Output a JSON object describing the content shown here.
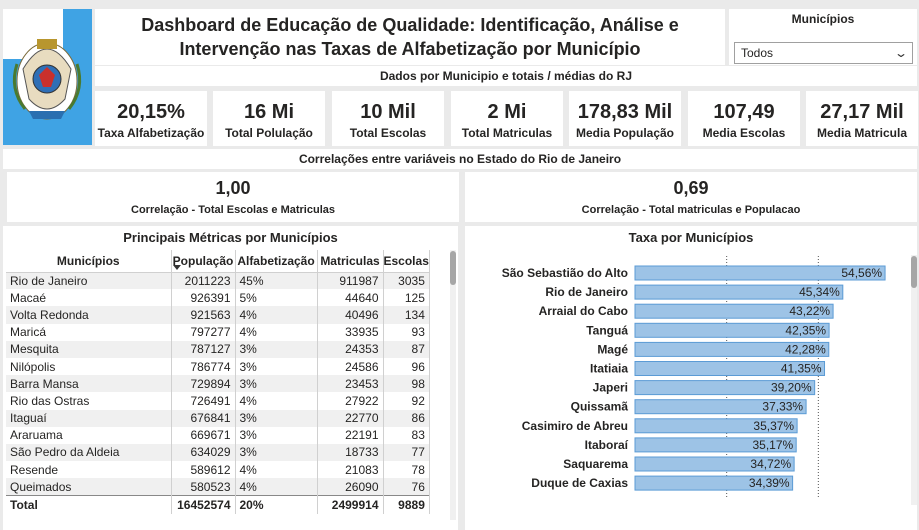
{
  "header": {
    "back_icon": "back-arrow-icon",
    "title": "Dashboard de Educação de Qualidade: Identificação, Análise e Intervenção nas Taxas de Alfabetização por Município",
    "logo": "rio-de-janeiro-coat-of-arms"
  },
  "filter": {
    "label": "Municípios",
    "selected": "Todos",
    "icon": "chevron-down-icon"
  },
  "subtitle": "Dados por Municipio e totais / médias do RJ",
  "kpis": [
    {
      "value": "20,15%",
      "label": "Taxa Alfabetização"
    },
    {
      "value": "16 Mi",
      "label": "Total Polulação"
    },
    {
      "value": "10 Mil",
      "label": "Total Escolas"
    },
    {
      "value": "2 Mi",
      "label": "Total Matriculas"
    },
    {
      "value": "178,83 Mil",
      "label": "Media População"
    },
    {
      "value": "107,49",
      "label": "Media Escolas"
    },
    {
      "value": "27,17 Mil",
      "label": "Media Matricula"
    }
  ],
  "correlations_header": "Correlações entre variáveis no Estado do Rio de Janeiro",
  "correlations": [
    {
      "value": "1,00",
      "label": "Correlação - Total Escolas e Matriculas"
    },
    {
      "value": "0,69",
      "label": "Correlação - Total matriculas e Populacao"
    }
  ],
  "table": {
    "title": "Principais Métricas por Municípios",
    "columns": [
      "Municípios",
      "População",
      "Alfabetização",
      "Matriculas",
      "Escolas"
    ],
    "rows": [
      [
        "Rio de Janeiro",
        "2011223",
        "45%",
        "911987",
        "3035"
      ],
      [
        "Macaé",
        "926391",
        "5%",
        "44640",
        "125"
      ],
      [
        "Volta Redonda",
        "921563",
        "4%",
        "40496",
        "134"
      ],
      [
        "Maricá",
        "797277",
        "4%",
        "33935",
        "93"
      ],
      [
        "Mesquita",
        "787127",
        "3%",
        "24353",
        "87"
      ],
      [
        "Nilópolis",
        "786774",
        "3%",
        "24586",
        "96"
      ],
      [
        "Barra Mansa",
        "729894",
        "3%",
        "23453",
        "98"
      ],
      [
        "Rio das Ostras",
        "726491",
        "4%",
        "27922",
        "92"
      ],
      [
        "Itaguaí",
        "676841",
        "3%",
        "22770",
        "86"
      ],
      [
        "Araruama",
        "669671",
        "3%",
        "22191",
        "83"
      ],
      [
        "São Pedro da Aldeia",
        "634029",
        "3%",
        "18733",
        "77"
      ],
      [
        "Resende",
        "589612",
        "4%",
        "21083",
        "78"
      ],
      [
        "Queimados",
        "580523",
        "4%",
        "26090",
        "76"
      ]
    ],
    "total": [
      "Total",
      "16452574",
      "20%",
      "2499914",
      "9889"
    ]
  },
  "chart_data": {
    "type": "bar",
    "orientation": "horizontal",
    "title": "Taxa por Municípios",
    "categories": [
      "São Sebastião do Alto",
      "Rio de Janeiro",
      "Arraial do Cabo",
      "Tanguá",
      "Magé",
      "Itatiaia",
      "Japeri",
      "Quissamã",
      "Casimiro de Abreu",
      "Itaboraí",
      "Saquarema",
      "Duque de Caxias"
    ],
    "values": [
      54.56,
      45.34,
      43.22,
      42.35,
      42.28,
      41.35,
      39.2,
      37.33,
      35.37,
      35.17,
      34.72,
      34.39
    ],
    "labels": [
      "54,56%",
      "45,34%",
      "43,22%",
      "42,35%",
      "42,28%",
      "41,35%",
      "39,20%",
      "37,33%",
      "35,37%",
      "35,17%",
      "34,72%",
      "34,39%"
    ],
    "xlim": [
      0,
      60
    ],
    "gridlines": [
      20,
      40
    ],
    "color": "#9dc3e6",
    "edge_color": "#5b9bd5"
  }
}
